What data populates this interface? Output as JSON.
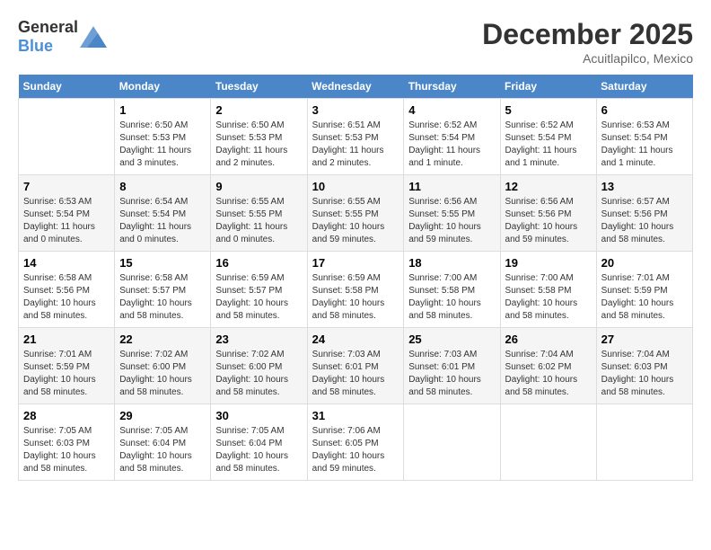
{
  "header": {
    "logo_general": "General",
    "logo_blue": "Blue",
    "month": "December 2025",
    "location": "Acuitlapilco, Mexico"
  },
  "days_of_week": [
    "Sunday",
    "Monday",
    "Tuesday",
    "Wednesday",
    "Thursday",
    "Friday",
    "Saturday"
  ],
  "weeks": [
    [
      {
        "day": "",
        "info": ""
      },
      {
        "day": "1",
        "info": "Sunrise: 6:50 AM\nSunset: 5:53 PM\nDaylight: 11 hours\nand 3 minutes."
      },
      {
        "day": "2",
        "info": "Sunrise: 6:50 AM\nSunset: 5:53 PM\nDaylight: 11 hours\nand 2 minutes."
      },
      {
        "day": "3",
        "info": "Sunrise: 6:51 AM\nSunset: 5:53 PM\nDaylight: 11 hours\nand 2 minutes."
      },
      {
        "day": "4",
        "info": "Sunrise: 6:52 AM\nSunset: 5:54 PM\nDaylight: 11 hours\nand 1 minute."
      },
      {
        "day": "5",
        "info": "Sunrise: 6:52 AM\nSunset: 5:54 PM\nDaylight: 11 hours\nand 1 minute."
      },
      {
        "day": "6",
        "info": "Sunrise: 6:53 AM\nSunset: 5:54 PM\nDaylight: 11 hours\nand 1 minute."
      }
    ],
    [
      {
        "day": "7",
        "info": "Sunrise: 6:53 AM\nSunset: 5:54 PM\nDaylight: 11 hours\nand 0 minutes."
      },
      {
        "day": "8",
        "info": "Sunrise: 6:54 AM\nSunset: 5:54 PM\nDaylight: 11 hours\nand 0 minutes."
      },
      {
        "day": "9",
        "info": "Sunrise: 6:55 AM\nSunset: 5:55 PM\nDaylight: 11 hours\nand 0 minutes."
      },
      {
        "day": "10",
        "info": "Sunrise: 6:55 AM\nSunset: 5:55 PM\nDaylight: 10 hours\nand 59 minutes."
      },
      {
        "day": "11",
        "info": "Sunrise: 6:56 AM\nSunset: 5:55 PM\nDaylight: 10 hours\nand 59 minutes."
      },
      {
        "day": "12",
        "info": "Sunrise: 6:56 AM\nSunset: 5:56 PM\nDaylight: 10 hours\nand 59 minutes."
      },
      {
        "day": "13",
        "info": "Sunrise: 6:57 AM\nSunset: 5:56 PM\nDaylight: 10 hours\nand 58 minutes."
      }
    ],
    [
      {
        "day": "14",
        "info": "Sunrise: 6:58 AM\nSunset: 5:56 PM\nDaylight: 10 hours\nand 58 minutes."
      },
      {
        "day": "15",
        "info": "Sunrise: 6:58 AM\nSunset: 5:57 PM\nDaylight: 10 hours\nand 58 minutes."
      },
      {
        "day": "16",
        "info": "Sunrise: 6:59 AM\nSunset: 5:57 PM\nDaylight: 10 hours\nand 58 minutes."
      },
      {
        "day": "17",
        "info": "Sunrise: 6:59 AM\nSunset: 5:58 PM\nDaylight: 10 hours\nand 58 minutes."
      },
      {
        "day": "18",
        "info": "Sunrise: 7:00 AM\nSunset: 5:58 PM\nDaylight: 10 hours\nand 58 minutes."
      },
      {
        "day": "19",
        "info": "Sunrise: 7:00 AM\nSunset: 5:58 PM\nDaylight: 10 hours\nand 58 minutes."
      },
      {
        "day": "20",
        "info": "Sunrise: 7:01 AM\nSunset: 5:59 PM\nDaylight: 10 hours\nand 58 minutes."
      }
    ],
    [
      {
        "day": "21",
        "info": "Sunrise: 7:01 AM\nSunset: 5:59 PM\nDaylight: 10 hours\nand 58 minutes."
      },
      {
        "day": "22",
        "info": "Sunrise: 7:02 AM\nSunset: 6:00 PM\nDaylight: 10 hours\nand 58 minutes."
      },
      {
        "day": "23",
        "info": "Sunrise: 7:02 AM\nSunset: 6:00 PM\nDaylight: 10 hours\nand 58 minutes."
      },
      {
        "day": "24",
        "info": "Sunrise: 7:03 AM\nSunset: 6:01 PM\nDaylight: 10 hours\nand 58 minutes."
      },
      {
        "day": "25",
        "info": "Sunrise: 7:03 AM\nSunset: 6:01 PM\nDaylight: 10 hours\nand 58 minutes."
      },
      {
        "day": "26",
        "info": "Sunrise: 7:04 AM\nSunset: 6:02 PM\nDaylight: 10 hours\nand 58 minutes."
      },
      {
        "day": "27",
        "info": "Sunrise: 7:04 AM\nSunset: 6:03 PM\nDaylight: 10 hours\nand 58 minutes."
      }
    ],
    [
      {
        "day": "28",
        "info": "Sunrise: 7:05 AM\nSunset: 6:03 PM\nDaylight: 10 hours\nand 58 minutes."
      },
      {
        "day": "29",
        "info": "Sunrise: 7:05 AM\nSunset: 6:04 PM\nDaylight: 10 hours\nand 58 minutes."
      },
      {
        "day": "30",
        "info": "Sunrise: 7:05 AM\nSunset: 6:04 PM\nDaylight: 10 hours\nand 58 minutes."
      },
      {
        "day": "31",
        "info": "Sunrise: 7:06 AM\nSunset: 6:05 PM\nDaylight: 10 hours\nand 59 minutes."
      },
      {
        "day": "",
        "info": ""
      },
      {
        "day": "",
        "info": ""
      },
      {
        "day": "",
        "info": ""
      }
    ]
  ]
}
